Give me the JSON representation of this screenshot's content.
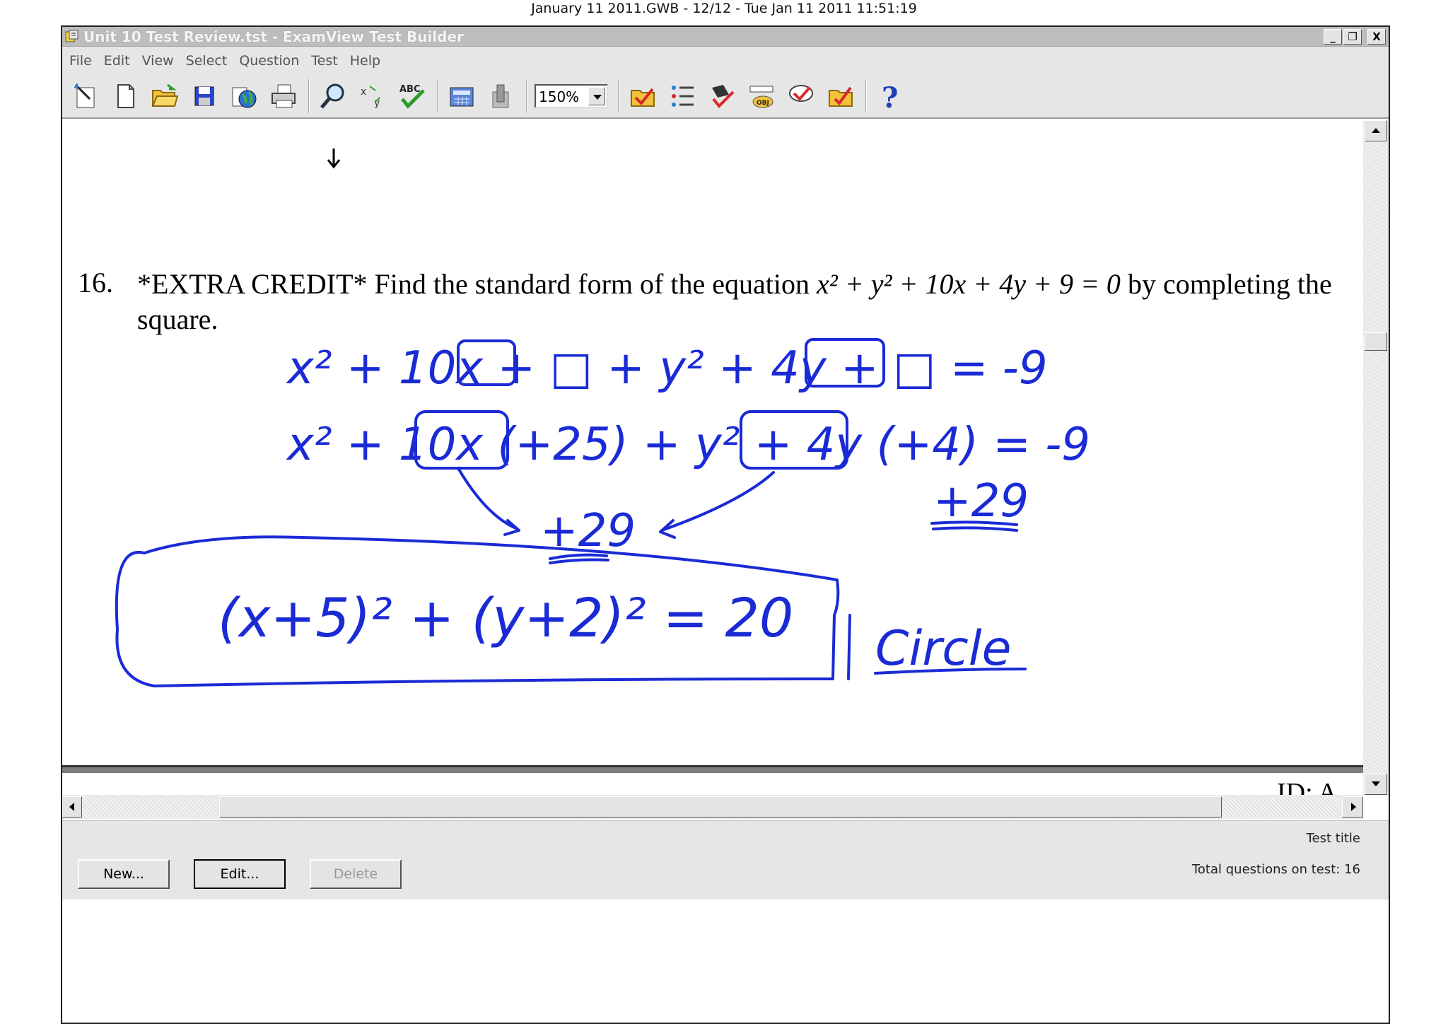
{
  "page_header": "January 11 2011.GWB - 12/12 - Tue Jan 11 2011 11:51:19",
  "window": {
    "title": "Unit 10 Test Review.tst - ExamView Test Builder",
    "buttons": [
      "_",
      "❐",
      "X"
    ]
  },
  "menu": [
    "File",
    "Edit",
    "View",
    "Select",
    "Question",
    "Test",
    "Help"
  ],
  "toolbar": {
    "zoom": "150%",
    "spell_label": "ABC",
    "help_glyph": "?"
  },
  "question": {
    "number": "16.",
    "text_before": "*EXTRA CREDIT* Find the standard form of the equation ",
    "equation_plain": "x² + y² + 10x + 4y + 9 = 0",
    "text_after": " by completing the",
    "line2": "square."
  },
  "handwriting": {
    "ink_color": "#1a2bd6",
    "line1": "x² + 10x + □ + y² + 4y + □ = -9",
    "line2": "x² + 10x (+25) + y² + 4y (+4) = -9",
    "line3_left": "+29",
    "line3_right": "+29",
    "answer": "(x+5)² + (y+2)² = 20",
    "shape": "Circle"
  },
  "lower_page": {
    "id_label": "ID: A"
  },
  "bottom": {
    "new_label": "New...",
    "edit_label": "Edit...",
    "delete_label": "Delete",
    "test_title_label": "Test title",
    "total_questions": "Total questions on test: 16"
  }
}
